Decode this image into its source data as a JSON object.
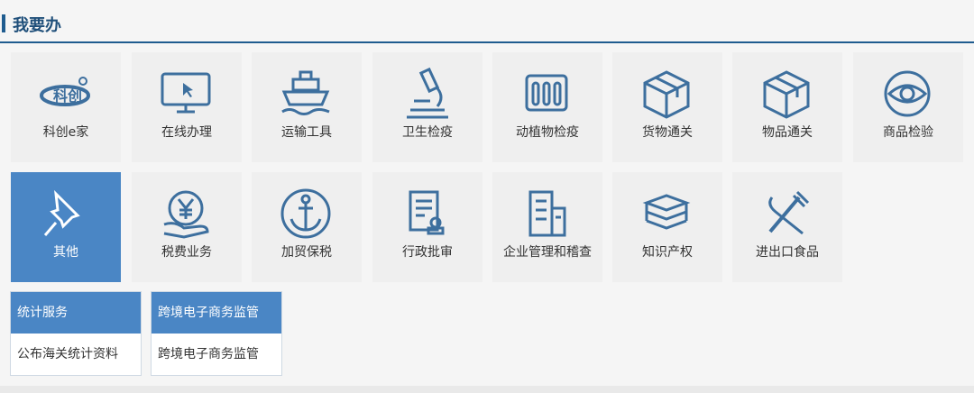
{
  "section": {
    "title": "我要办"
  },
  "tiles_row1": [
    {
      "label": "科创e家",
      "icon": "kechuang-logo-icon"
    },
    {
      "label": "在线办理",
      "icon": "monitor-icon"
    },
    {
      "label": "运输工具",
      "icon": "ship-icon"
    },
    {
      "label": "卫生检疫",
      "icon": "microscope-icon"
    },
    {
      "label": "动植物检疫",
      "icon": "test-tubes-icon"
    },
    {
      "label": "货物通关",
      "icon": "box-icon"
    },
    {
      "label": "物品通关",
      "icon": "package-icon"
    },
    {
      "label": "商品检验",
      "icon": "eye-icon"
    }
  ],
  "tiles_row2": [
    {
      "label": "其他",
      "icon": "pushpin-icon"
    },
    {
      "label": "税费业务",
      "icon": "yen-hand-icon"
    },
    {
      "label": "加贸保税",
      "icon": "anchor-icon"
    },
    {
      "label": "行政批审",
      "icon": "document-stamp-icon"
    },
    {
      "label": "企业管理和稽查",
      "icon": "building-icon"
    },
    {
      "label": "知识产权",
      "icon": "books-icon"
    },
    {
      "label": "进出口食品",
      "icon": "fork-knife-icon"
    }
  ],
  "services": [
    {
      "header": "统计服务",
      "link": "公布海关统计资料"
    },
    {
      "header": "跨境电子商务监管",
      "link": "跨境电子商务监管"
    }
  ],
  "colors": {
    "accent": "#1f5c8f",
    "active": "#4a86c5",
    "icon": "#3d6f9e"
  }
}
